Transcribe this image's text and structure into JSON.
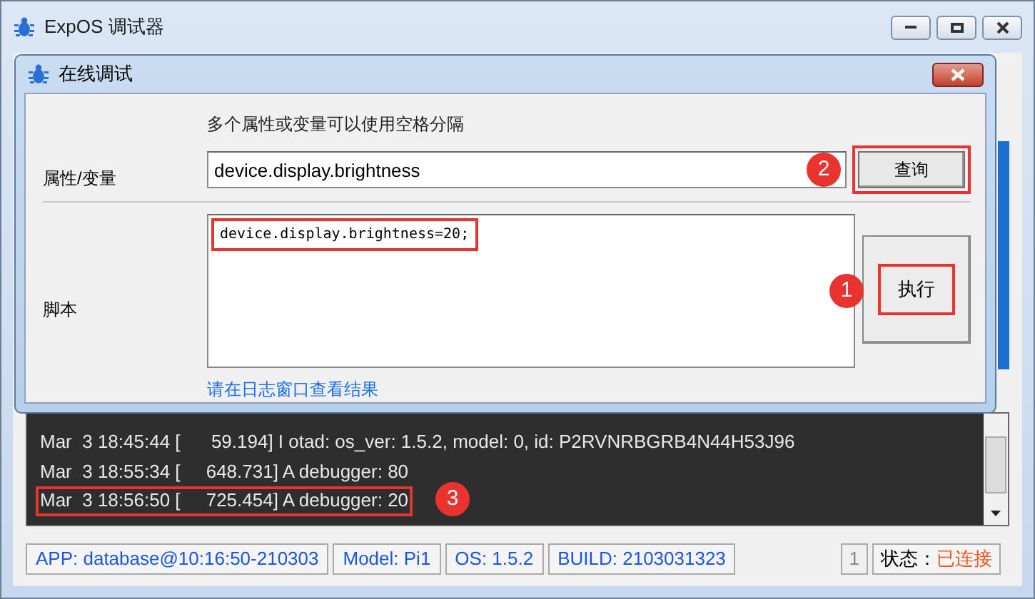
{
  "window": {
    "title": "ExpOS 调试器"
  },
  "dialog": {
    "title": "在线调试",
    "hint": "多个属性或变量可以使用空格分隔",
    "property": {
      "label": "属性/变量",
      "value": "device.display.brightness"
    },
    "query_button": {
      "label": "查询",
      "highlighted": true,
      "callout": "2"
    },
    "script": {
      "label": "脚本",
      "lines": [
        {
          "text": "device.display.brightness=20;",
          "highlighted": true
        }
      ]
    },
    "execute_button": {
      "label": "执行",
      "highlighted": true,
      "callout": "1"
    },
    "result_link": "请在日志窗口查看结果"
  },
  "log": {
    "lines": [
      {
        "time": "Mar  3 18:45:44",
        "stamp": "[      59.194]",
        "message": "I otad: os_ver: 1.5.2, model: 0, id: P2RVNRBGRB4N44H53J96",
        "highlighted": false
      },
      {
        "time": "Mar  3 18:55:34",
        "stamp": "[     648.731]",
        "message": "A debugger: 80",
        "highlighted": false
      },
      {
        "time": "Mar  3 18:56:50",
        "stamp": "[     725.454]",
        "message": "A debugger: 20",
        "highlighted": true,
        "callout": "3"
      }
    ]
  },
  "status_bar": {
    "items": [
      "APP: database@10:16:50-210303",
      "Model: Pi1",
      "OS: 1.5.2",
      "BUILD: 2103031323"
    ],
    "count": "1",
    "status_label": "状态：",
    "status_value": "已连接"
  }
}
